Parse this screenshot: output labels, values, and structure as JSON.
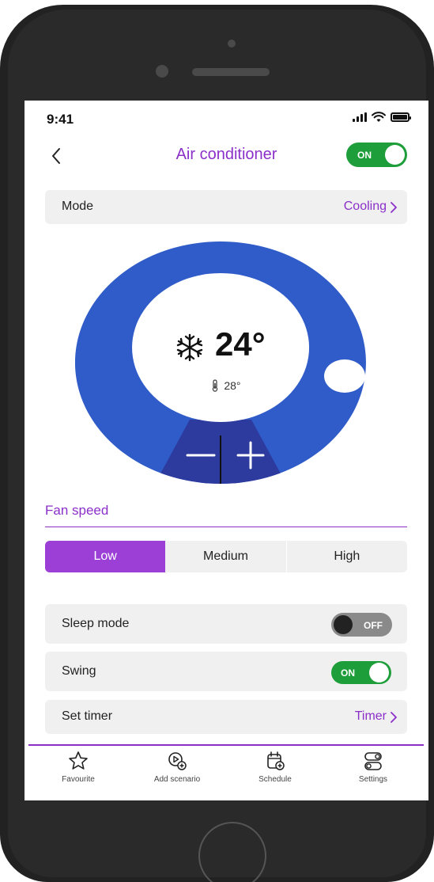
{
  "status_bar": {
    "time": "9:41"
  },
  "header": {
    "title": "Air conditioner",
    "power_toggle_label": "ON"
  },
  "mode": {
    "label": "Mode",
    "value": "Cooling"
  },
  "thermostat": {
    "set_temperature": "24°",
    "room_temperature": "28°"
  },
  "fan_speed": {
    "title": "Fan speed",
    "options": [
      "Low",
      "Medium",
      "High"
    ],
    "selected": "Low"
  },
  "sleep_mode": {
    "label": "Sleep mode",
    "toggle_label": "OFF"
  },
  "swing": {
    "label": "Swing",
    "toggle_label": "ON"
  },
  "timer": {
    "label": "Set timer",
    "value": "Timer"
  },
  "bottom_nav": {
    "items": [
      {
        "label": "Favourite",
        "icon": "star-icon"
      },
      {
        "label": "Add scenario",
        "icon": "add-scenario-icon"
      },
      {
        "label": "Schedule",
        "icon": "calendar-add-icon"
      },
      {
        "label": "Settings",
        "icon": "settings-toggles-icon"
      }
    ]
  },
  "colors": {
    "accent": "#8B2FC9",
    "segment_active": "#9B3FD6",
    "toggle_on": "#1e9e3a",
    "dial": "#2f5cc8",
    "dial_dark": "#2d3a9e"
  }
}
